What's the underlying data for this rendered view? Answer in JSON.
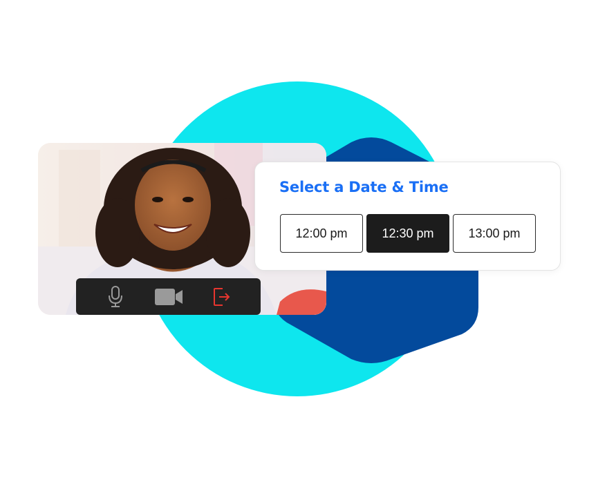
{
  "scheduler": {
    "title": "Select a Date & Time",
    "time_slots": [
      {
        "label": "12:00 pm",
        "selected": false
      },
      {
        "label": "12:30 pm",
        "selected": true
      },
      {
        "label": "13:00 pm",
        "selected": false
      }
    ]
  },
  "video_call": {
    "controls": [
      {
        "icon": "microphone-icon",
        "color": "#9a9a9a"
      },
      {
        "icon": "video-camera-icon",
        "color": "#9a9a9a"
      },
      {
        "icon": "leave-call-icon",
        "color": "#e8362f"
      }
    ]
  },
  "colors": {
    "cyan_circle": "#0ee6ee",
    "blue_hexagon": "#034a9c",
    "title_blue": "#1a6ff5",
    "controls_bar": "#222222",
    "selected_slot": "#1c1c1c"
  }
}
